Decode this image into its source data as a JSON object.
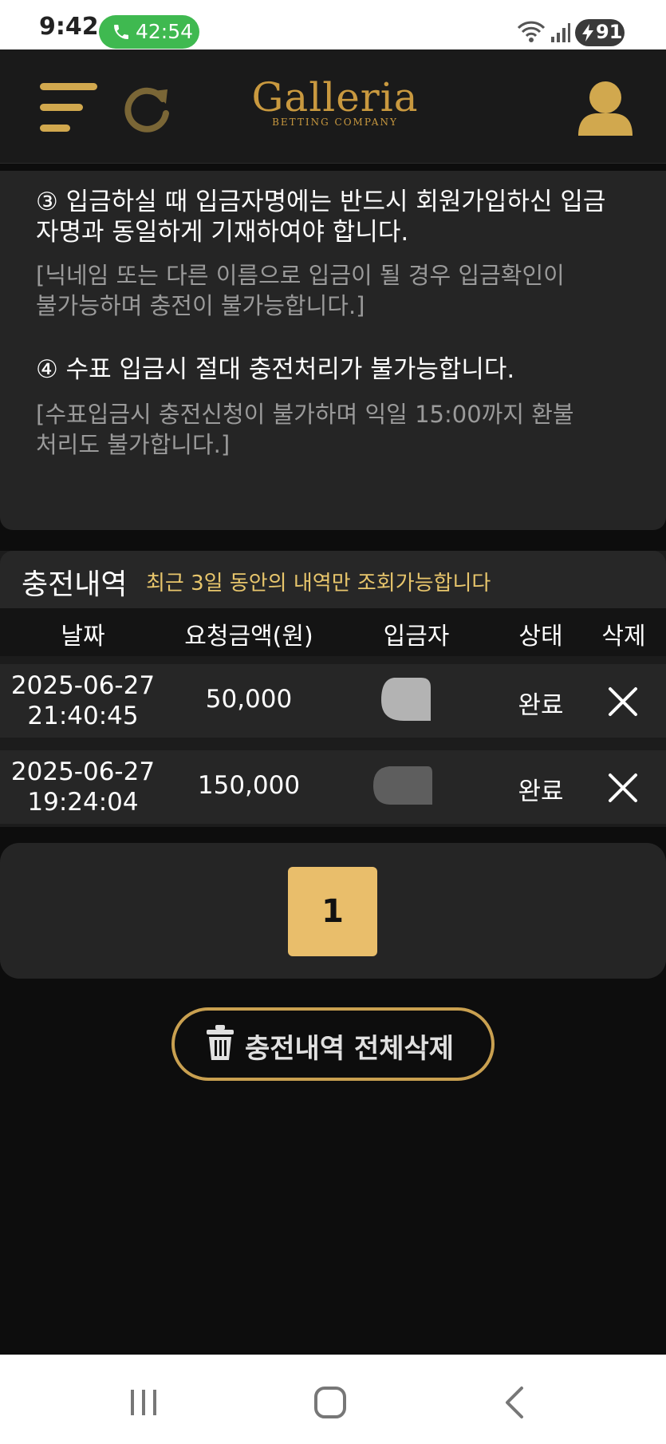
{
  "status_bar": {
    "time": "9:42",
    "call_timer": "42:54",
    "battery": "91",
    "icons": [
      "phone-icon",
      "wifi-icon",
      "signal-icon",
      "battery-charging-icon"
    ]
  },
  "header": {
    "logo_main": "Galleria",
    "logo_sub": "BETTING COMPANY",
    "icons": [
      "menu-icon",
      "refresh-icon",
      "user-icon"
    ]
  },
  "notice": {
    "item3_line1": "③ 입금하실 때 입금자명에는 반드시 회원가입하신 입금",
    "item3_line2": "자명과 동일하게 기재하여야 합니다.",
    "item3_sub_line1": "[닉네임 또는 다른 이름으로 입금이 될 경우 입금확인이",
    "item3_sub_line2": "불가능하며 충전이 불가능합니다.]",
    "item4": "④ 수표 입금시 절대 충전처리가 불가능합니다.",
    "item4_sub_line1": "[수표입금시 충전신청이 불가하며 익일 15:00까지 환불",
    "item4_sub_line2": "처리도 불가합니다.]"
  },
  "history": {
    "title": "충전내역",
    "note": "최근 3일 동안의 내역만 조회가능합니다",
    "columns": [
      "날짜",
      "요청금액(원)",
      "입금자",
      "상태",
      "삭제"
    ],
    "rows": [
      {
        "date": "2025-06-27",
        "time": "21:40:45",
        "amount": "50,000",
        "status": "완료"
      },
      {
        "date": "2025-06-27",
        "time": "19:24:04",
        "amount": "150,000",
        "status": "완료"
      }
    ]
  },
  "pagination": {
    "current_page": "1"
  },
  "actions": {
    "delete_all_label": "충전내역 전체삭제"
  },
  "colors": {
    "accent_gold": "#d1a84e",
    "note_yellow": "#e8c66c",
    "page_button": "#e9be6b",
    "call_green": "#3fb950"
  }
}
